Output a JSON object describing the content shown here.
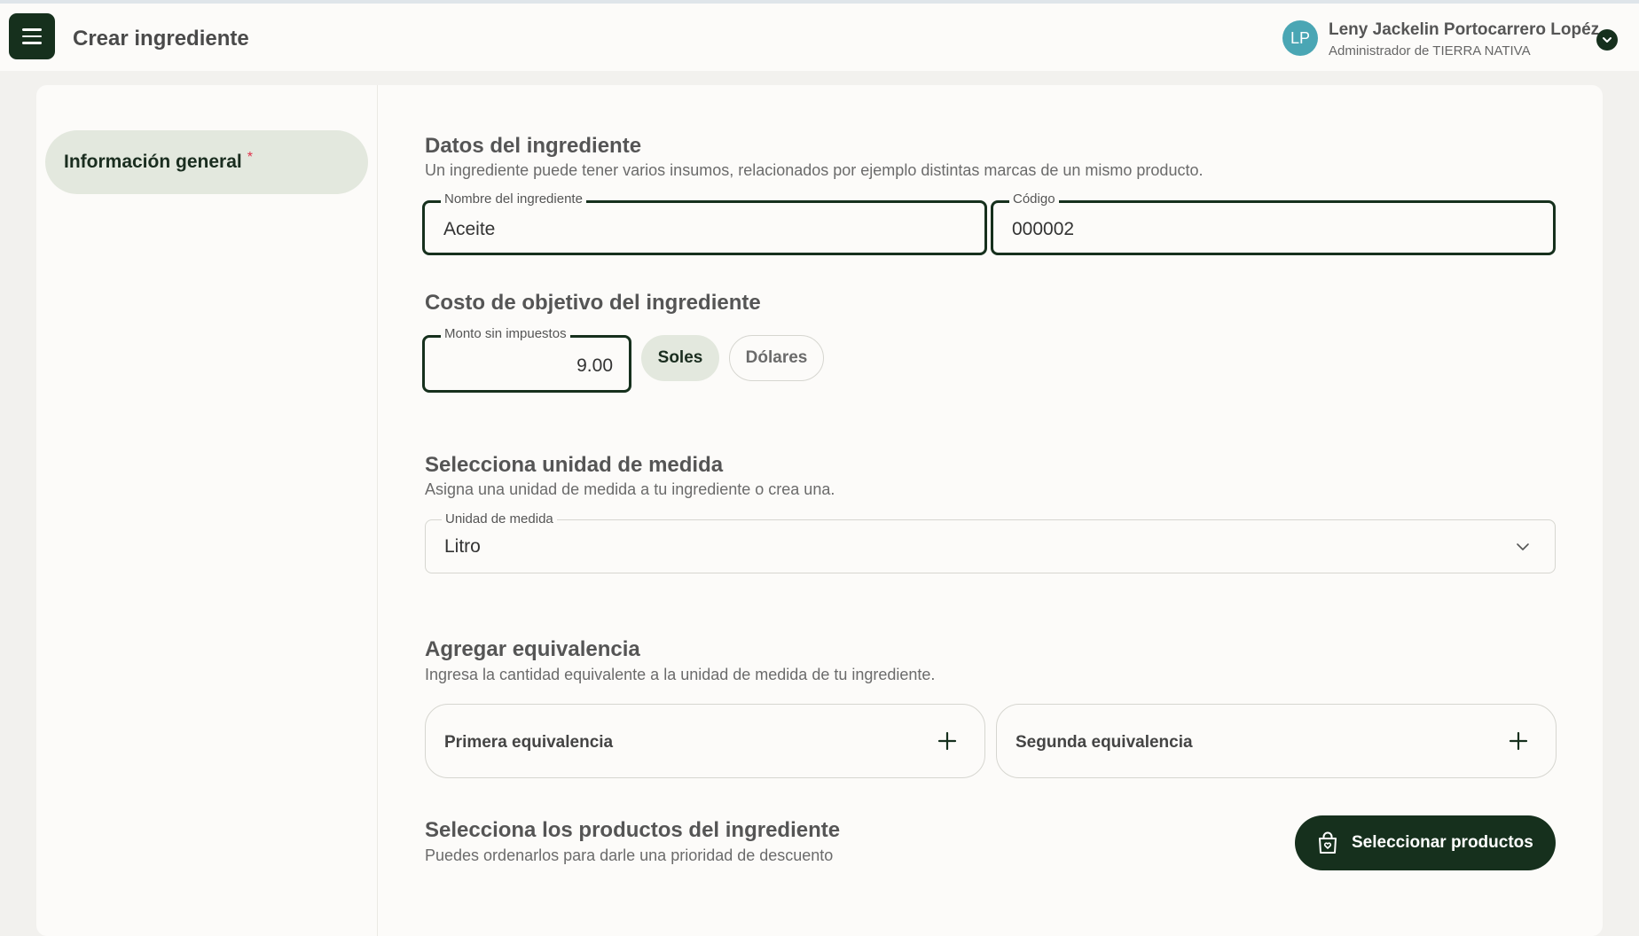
{
  "header": {
    "title": "Crear ingrediente",
    "user": {
      "initials": "LP",
      "name": "Leny Jackelin Portocarrero Lopéz",
      "role": "Administrador de TIERRA NATIVA"
    }
  },
  "sidebar": {
    "items": [
      {
        "label": "Información general",
        "required_mark": "*",
        "active": true
      }
    ]
  },
  "sections": {
    "datos": {
      "title": "Datos del ingrediente",
      "description": "Un ingrediente puede tener varios insumos, relacionados por ejemplo distintas marcas de un mismo producto.",
      "name_field": {
        "label": "Nombre del ingrediente",
        "value": "Aceite"
      },
      "code_field": {
        "label": "Código",
        "value": "000002"
      }
    },
    "costo": {
      "title": "Costo de objetivo del ingrediente",
      "amount_field": {
        "label": "Monto sin impuestos",
        "value": "9.00"
      },
      "currencies": [
        {
          "label": "Soles",
          "selected": true
        },
        {
          "label": "Dólares",
          "selected": false
        }
      ]
    },
    "unidad": {
      "title": "Selecciona unidad de medida",
      "description": "Asigna una unidad de medida a tu ingrediente o crea una.",
      "unit_field": {
        "label": "Unidad de medida",
        "value": "Litro"
      }
    },
    "equivalencia": {
      "title": "Agregar equivalencia",
      "description": "Ingresa la cantidad equivalente a la unidad de medida de tu ingrediente.",
      "first_label": "Primera equivalencia",
      "second_label": "Segunda equivalencia"
    },
    "productos": {
      "title": "Selecciona los productos del ingrediente",
      "description": "Puedes ordenarlos para darle una prioridad de descuento",
      "button_label": "Seleccionar productos"
    }
  },
  "colors": {
    "primary_dark": "#16301d",
    "active_chip": "#e3e8de",
    "avatar": "#4aa6b4",
    "required": "#e0324b"
  },
  "icons": [
    "menu-icon",
    "chevron-down-icon",
    "plus-icon",
    "shopping-bag-icon"
  ]
}
